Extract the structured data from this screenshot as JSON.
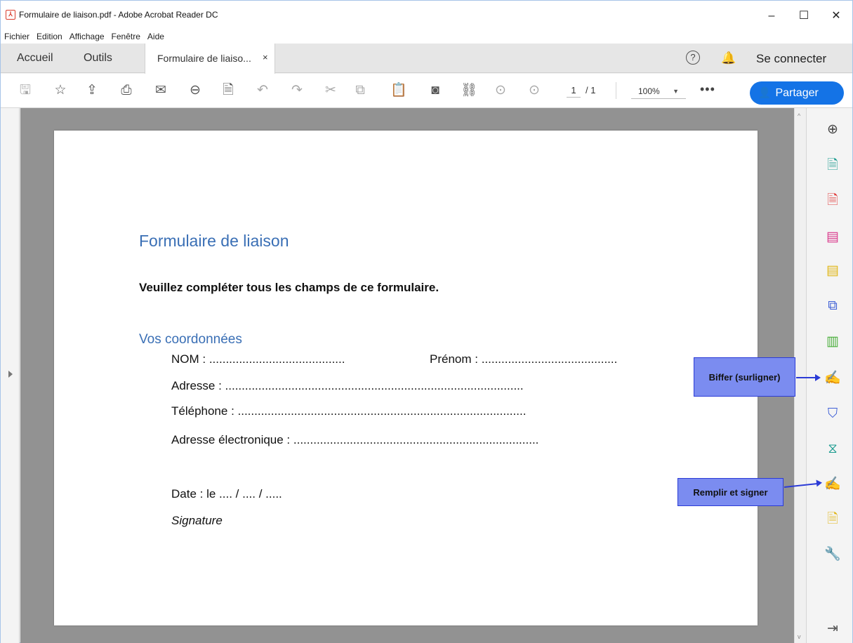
{
  "window": {
    "title": "Formulaire de liaison.pdf - Adobe Acrobat Reader DC",
    "minimize": "–",
    "maximize": "☐",
    "close": "✕"
  },
  "menu": [
    "Fichier",
    "Edition",
    "Affichage",
    "Fenêtre",
    "Aide"
  ],
  "tabs": {
    "home": "Accueil",
    "tools": "Outils",
    "document": "Formulaire de liaiso...",
    "document_close": "×"
  },
  "header_right": {
    "help": "?",
    "connect": "Se connecter"
  },
  "toolbar": {
    "page_current": "1",
    "page_total": "/ 1",
    "zoom": "100%",
    "more": "•••",
    "share": "Partager"
  },
  "document": {
    "title": "Formulaire de liaison",
    "instruction": "Veuillez compléter tous les champs de ce formulaire.",
    "section": "Vos coordonnées",
    "fields": {
      "nom": "NOM : .........................................",
      "prenom": "Prénom : .........................................",
      "adresse": "Adresse : ..........................................................................................",
      "telephone": "Téléphone : .......................................................................................",
      "email": "Adresse électronique : ..........................................................................",
      "date": "Date : le .... / .... / .....",
      "signature": "Signature"
    }
  },
  "annotations": {
    "biffer": "Biffer (surligner)",
    "remplir": "Remplir et signer"
  },
  "colors": {
    "accent": "#1473e6",
    "doc_heading": "#3a6fb5",
    "callout_fill": "#7b8cf0",
    "callout_border": "#2b3bd6"
  }
}
